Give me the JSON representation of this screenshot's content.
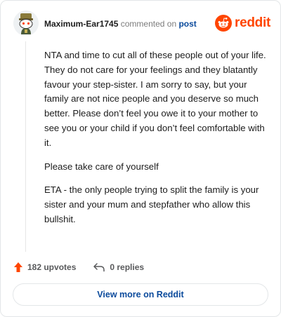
{
  "header": {
    "author": "Maximum-Ear1745",
    "verb": "commented on",
    "post_link": "post",
    "brand": "reddit"
  },
  "comment": {
    "paragraphs": [
      "NTA and time to cut all of these people out of your life. They do not care for your feelings and they blatantly favour your step-sister. I am sorry to say, but your family are not nice people and you deserve so much better. Please don’t feel you owe it to your mother to see you or your child if you don’t feel comfortable with it.",
      "Please take care of yourself",
      "ETA - the only people trying to split the family is your sister and your mum and stepfather who allow this bullshit."
    ]
  },
  "actions": {
    "upvotes": "182 upvotes",
    "replies": "0 replies"
  },
  "footer": {
    "view_more": "View more on Reddit"
  },
  "colors": {
    "brand": "#ff4500",
    "link": "#0a4a9c"
  },
  "icons": {
    "avatar": "snoo-avatar",
    "brand": "reddit-logo-icon",
    "upvote": "upvote-arrow-icon",
    "reply": "reply-arrow-icon"
  }
}
